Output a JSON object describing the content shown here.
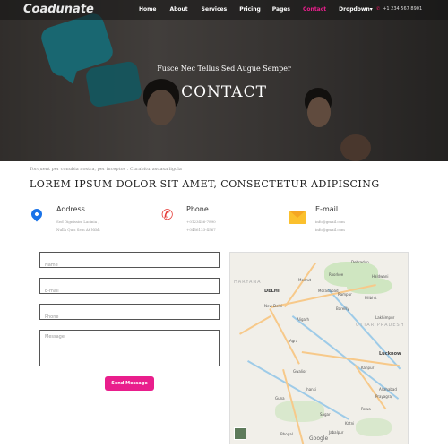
{
  "brand": {
    "logo": "Coadunate"
  },
  "nav": {
    "items": [
      "Home",
      "About",
      "Services",
      "Pricing",
      "Pages",
      "Contact",
      "Dropdown"
    ],
    "active_index": 5,
    "phone": "+1 234 567 8901"
  },
  "hero": {
    "subtitle": "Fusce Nec Tellus Sed Augue Semper",
    "title": "CONTACT"
  },
  "breadcrumb": "Torquent per conubia nostra, per inceptos . Curabiturasdasa ligula",
  "heading": "LOREM IPSUM DOLOR SIT AMET, CONSECTETUR ADIPISCING",
  "contact_info": {
    "address": {
      "title": "Address",
      "lines": [
        "Sed Dignissim Lacinia ,",
        "Nulla Quis Sem At Nibh"
      ]
    },
    "phone": {
      "title": "Phone",
      "lines": [
        "+0123456-7890",
        "+0456123-4567"
      ]
    },
    "email": {
      "title": "E-mail",
      "lines": [
        "info@gmail.com",
        "info@gmail.com"
      ]
    }
  },
  "form": {
    "name_placeholder": "Name",
    "email_placeholder": "E-mail",
    "phone_placeholder": "Phone",
    "message_placeholder": "Message",
    "submit_label": "Send Message"
  },
  "map": {
    "state_labels": [
      "HARYANA",
      "UTTAR PRADESH"
    ],
    "cities": [
      "Dehradun",
      "Haldwani",
      "Roorkee",
      "Rampur",
      "Bareilly",
      "DELHI",
      "New Delhi",
      "Moradabad",
      "Meerut",
      "Pilibhit",
      "Aligarh",
      "Lakhimpur",
      "Agra",
      "Lucknow",
      "Kanpur",
      "Gwalior",
      "Jhansi",
      "Allahabad",
      "Prayagraj",
      "Guna",
      "Sagar",
      "Jabalpur",
      "Rewa",
      "Katni",
      "Bhopal"
    ],
    "attribution": "Google"
  },
  "colors": {
    "accent": "#e91e8c",
    "pin": "#1a73e8",
    "phone_icon": "#e53935",
    "mail_icon": "#fbc02d"
  }
}
